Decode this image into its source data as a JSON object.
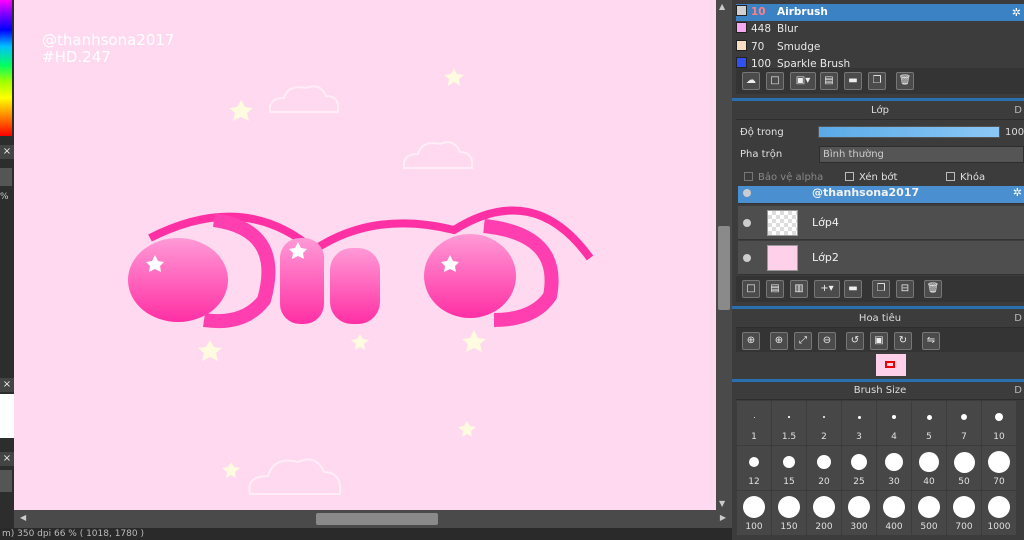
{
  "canvas": {
    "background": "#ffd9ef",
    "watermark_line1": "@thanhsona2017",
    "watermark_line2": "#HD.247"
  },
  "left_strip": {
    "close1": "×",
    "close2": "×",
    "close3": "×",
    "percent": "%"
  },
  "status": {
    "text": "m)  350 dpi  66 %  ( 1018, 1780 )"
  },
  "brush_list": [
    {
      "num": "10",
      "name": "Airbrush",
      "color": "#d0d0d0",
      "selected": true
    },
    {
      "num": "448",
      "name": "Blur",
      "color": "#f6a8f0",
      "selected": false
    },
    {
      "num": "70",
      "name": "Smudge",
      "color": "#f8dcc4",
      "selected": false
    },
    {
      "num": "100",
      "name": "Sparkle Brush",
      "color": "#3050f0",
      "selected": false
    }
  ],
  "layer_panel": {
    "title": "Lớp",
    "corner": "D",
    "opacity_label": "Độ trong",
    "opacity_value": "100",
    "opacity_fraction": 1.0,
    "blend_label": "Pha trộn",
    "blend_value": "Bình thường",
    "protect_alpha": "Bảo vệ alpha",
    "clipping": "Xén bớt",
    "lock": "Khóa"
  },
  "layers": [
    {
      "name": "@thanhsona2017",
      "selected": true
    },
    {
      "name": "Lớp4",
      "selected": false
    },
    {
      "name": "Lớp2",
      "selected": false
    }
  ],
  "navigator": {
    "title": "Hoa tiêu",
    "corner": "D"
  },
  "brush_size": {
    "title": "Brush Size",
    "corner": "D",
    "sizes": [
      "1",
      "1.5",
      "2",
      "3",
      "4",
      "5",
      "7",
      "10",
      "12",
      "15",
      "20",
      "25",
      "30",
      "40",
      "50",
      "70",
      "100",
      "150",
      "200",
      "300",
      "400",
      "500",
      "700",
      "1000"
    ]
  },
  "icons": {
    "gear": "✲"
  }
}
